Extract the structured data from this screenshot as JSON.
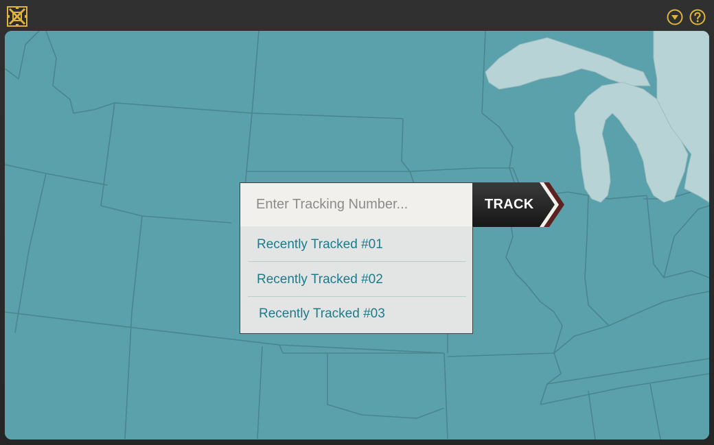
{
  "titlebar": {
    "logo_icon": "box-cross-logo-icon",
    "menu_icon": "chevron-down-circle-icon",
    "help_icon": "question-circle-icon",
    "accent_color": "#e0b43c"
  },
  "map": {
    "water_color": "#5ba1ab",
    "lake_color": "#b8d3d5",
    "border_color": "#4a858f"
  },
  "search": {
    "placeholder": "Enter Tracking Number...",
    "value": "",
    "button_label": "TRACK"
  },
  "recent": {
    "items": [
      {
        "label": "Recently Tracked #01"
      },
      {
        "label": "Recently Tracked #02"
      },
      {
        "label": "Recently Tracked #03"
      }
    ]
  }
}
